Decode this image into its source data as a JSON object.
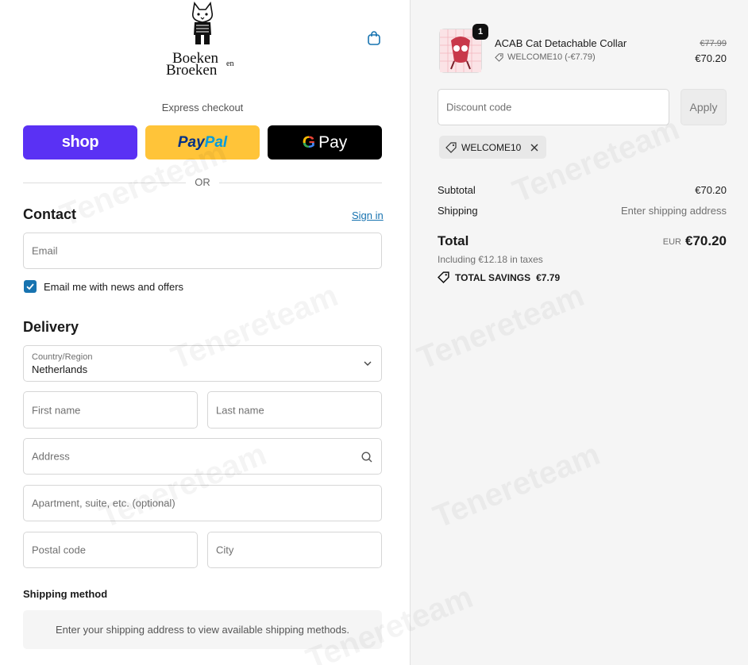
{
  "brand": {
    "logo_line1": "Boeken",
    "logo_line2": "Broeken",
    "logo_small": "en"
  },
  "express": {
    "label": "Express checkout",
    "shop_label": "shop",
    "paypal_part1": "Pay",
    "paypal_part2": "Pal",
    "gpay_g": "G",
    "gpay_label": "Pay",
    "shop_color": "#5a31f4",
    "paypal_color": "#ffc439",
    "gpay_color": "#000000"
  },
  "or_label": "OR",
  "contact": {
    "title": "Contact",
    "sign_in": "Sign in",
    "email_placeholder": "Email",
    "news_checkbox_label": "Email me with news and offers",
    "news_checked": true
  },
  "delivery": {
    "title": "Delivery",
    "country_label": "Country/Region",
    "country_value": "Netherlands",
    "first_name_placeholder": "First name",
    "last_name_placeholder": "Last name",
    "address_placeholder": "Address",
    "apartment_placeholder": "Apartment, suite, etc. (optional)",
    "postal_placeholder": "Postal code",
    "city_placeholder": "City"
  },
  "shipping_method": {
    "title": "Shipping method",
    "message": "Enter your shipping address to view available shipping methods."
  },
  "order": {
    "item": {
      "quantity": "1",
      "name": "ACAB Cat Detachable Collar",
      "discount": "WELCOME10 (-€7.79)",
      "price_original": "€77.99",
      "price_final": "€70.20"
    },
    "discount_placeholder": "Discount code",
    "apply_label": "Apply",
    "applied_code": "WELCOME10",
    "subtotal_label": "Subtotal",
    "subtotal_value": "€70.20",
    "shipping_label": "Shipping",
    "shipping_value": "Enter shipping address",
    "total_label": "Total",
    "total_currency": "EUR",
    "total_value": "€70.20",
    "tax_line": "Including €12.18 in taxes",
    "savings_label": "TOTAL SAVINGS",
    "savings_value": "€7.79"
  },
  "watermark": "Tenereteam",
  "colors": {
    "accent": "#1773b0",
    "summary_bg": "#f5f5f5"
  }
}
